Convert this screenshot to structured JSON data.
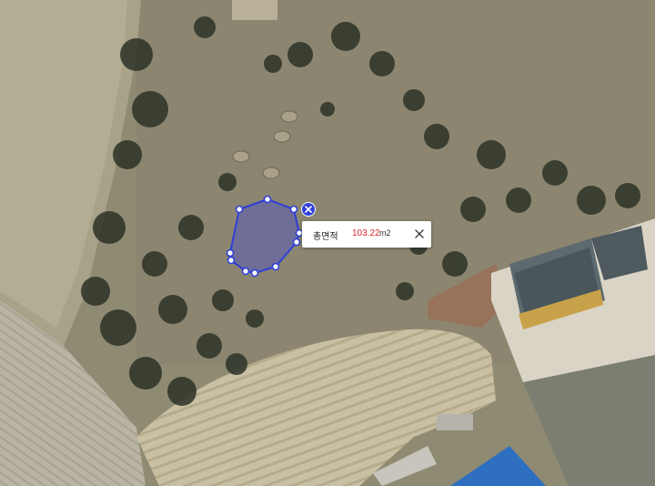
{
  "measurement": {
    "label": "총면적",
    "value": "103.22",
    "unit": "m2",
    "polygon_color": "#2f3fd8",
    "fill_color": "#4a52c8"
  },
  "icons": {
    "close": "close-icon",
    "delete": "delete-x-icon"
  }
}
